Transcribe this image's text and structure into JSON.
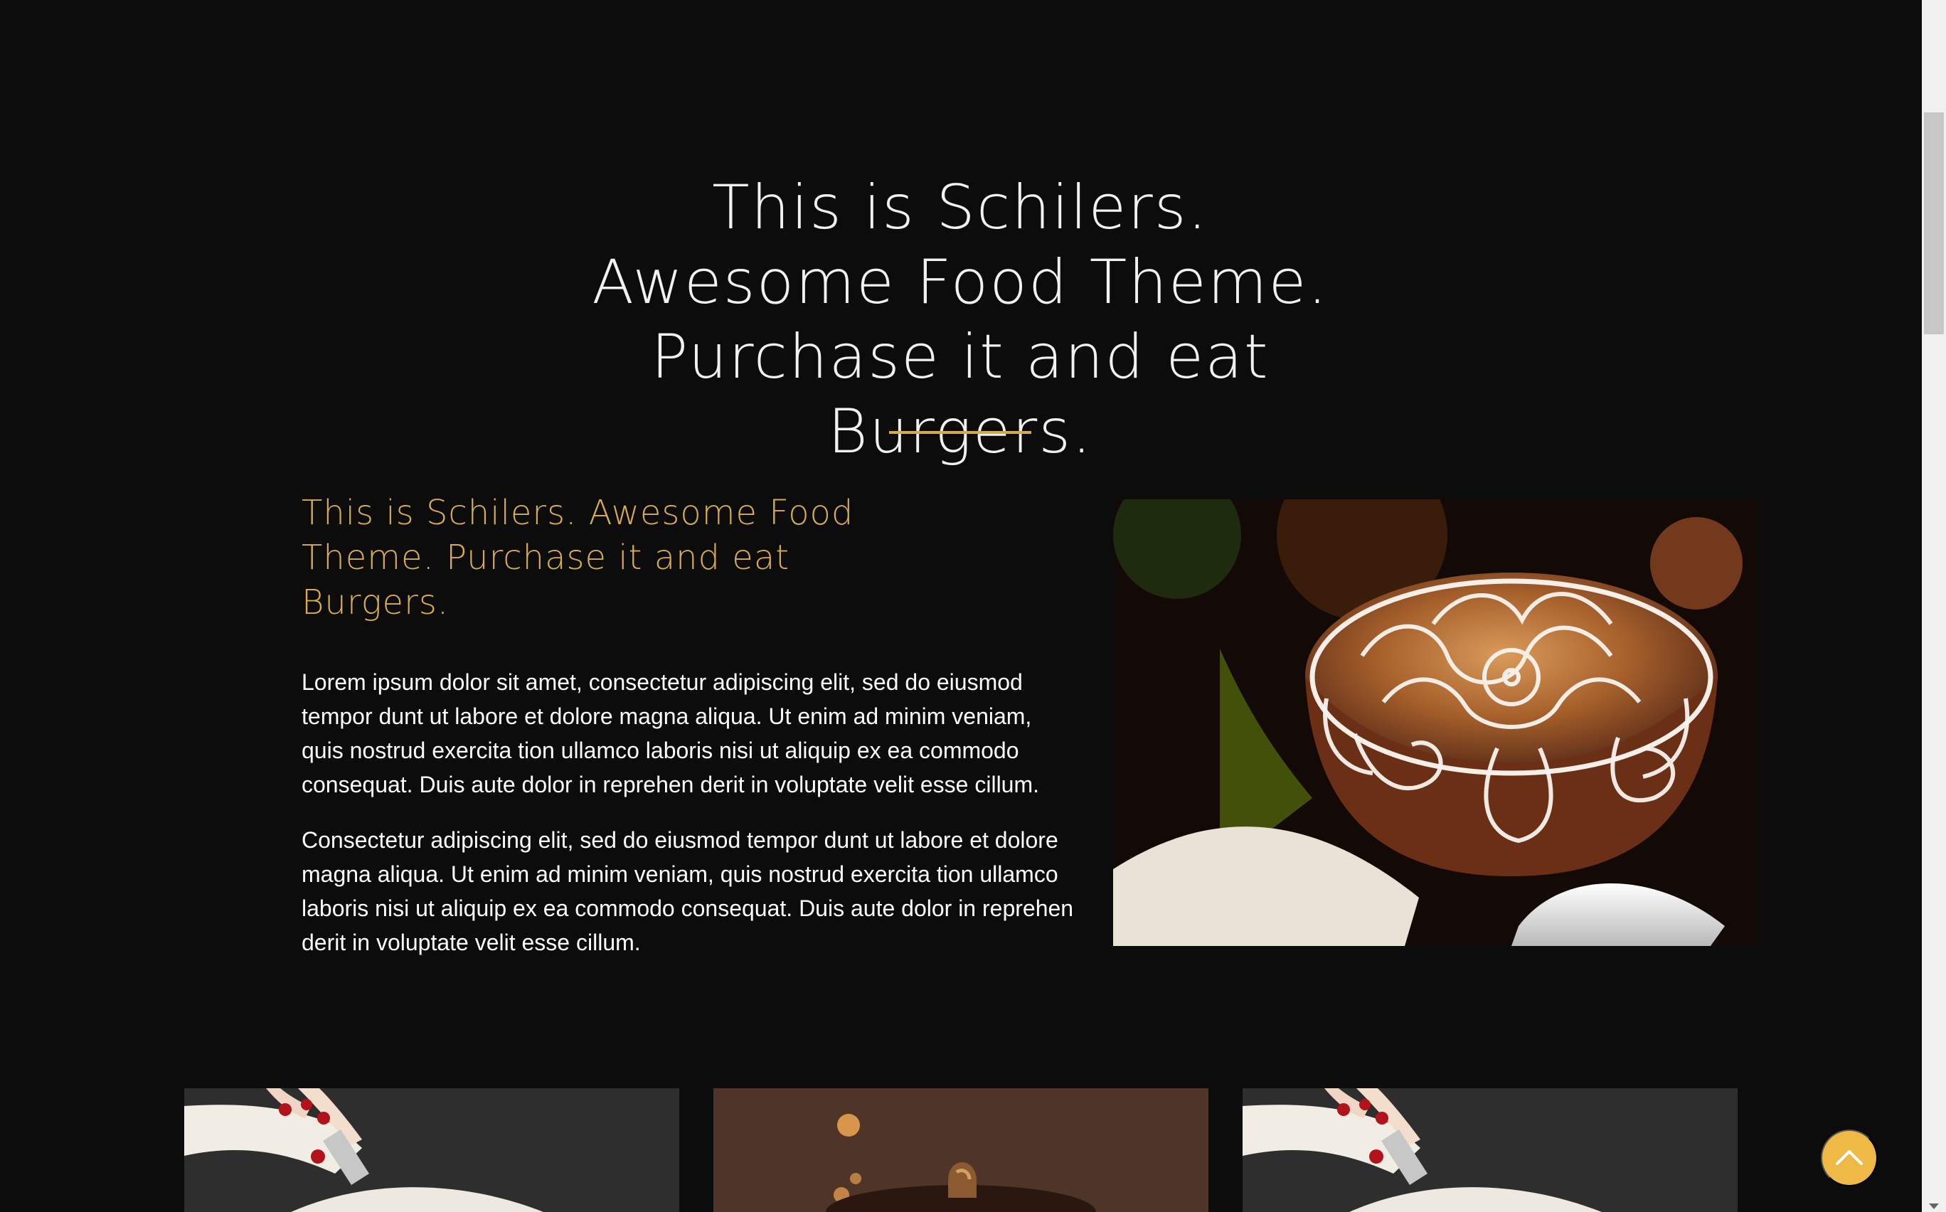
{
  "hero": {
    "title": "This is Schilers. Awesome Food Theme. Purchase it and eat Burgers."
  },
  "about": {
    "heading": "This is Schilers. Awesome Food Theme. Purchase it and eat Burgers.",
    "paragraphs": [
      "Lorem ipsum dolor sit amet, consectetur adipiscing elit, sed do eiusmod tempor dunt ut labore et dolore magna aliqua. Ut enim ad minim veniam, quis nostrud exercita tion ullamco laboris nisi ut aliquip ex ea commodo consequat. Duis aute dolor in reprehen derit in voluptate velit esse cillum.",
      "Consectetur adipiscing elit, sed do eiusmod tempor dunt ut labore et dolore magna aliqua. Ut enim ad minim veniam, quis nostrud exercita tion ullamco laboris nisi ut aliquip ex ea commodo consequat. Duis aute dolor in reprehen derit in voluptate velit esse cillum."
    ]
  },
  "colors": {
    "background": "#0c0c0d",
    "accent": "#d8ac4f",
    "back_to_top": "#efb946",
    "text": "#ffffff"
  },
  "icons": {
    "back_to_top": "chevron-up-icon",
    "scroll_down": "scroll-down-arrow-icon"
  }
}
